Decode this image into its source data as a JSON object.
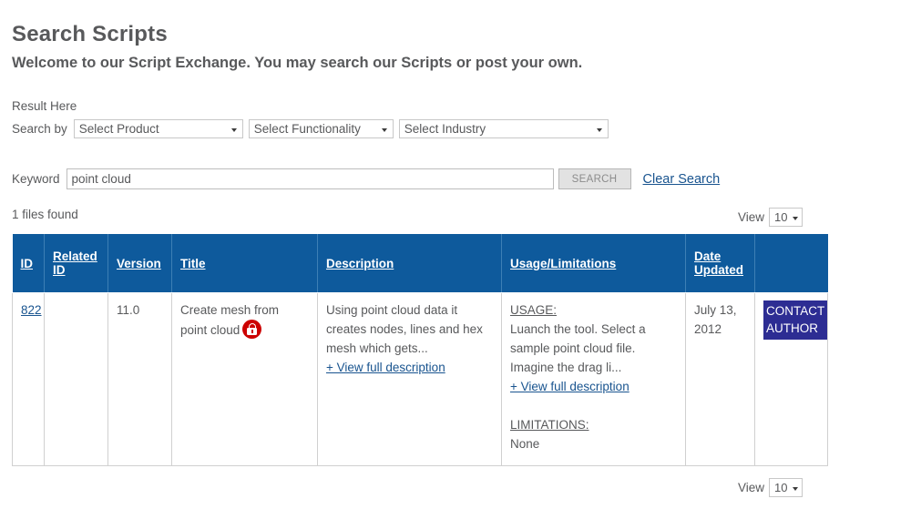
{
  "page": {
    "title": "Search Scripts",
    "subtitle": "Welcome to our Script Exchange. You may search our Scripts or post your own.",
    "result_here": "Result Here",
    "files_found": "1 files found"
  },
  "search": {
    "search_by_label": "Search by",
    "selects": [
      {
        "name": "product",
        "value": "Select Product"
      },
      {
        "name": "functionality",
        "value": "Select Functionality"
      },
      {
        "name": "industry",
        "value": "Select Industry"
      }
    ],
    "keyword_label": "Keyword",
    "keyword_value": "point cloud",
    "keyword_placeholder": "",
    "search_button": "SEARCH",
    "clear_search": "Clear Search"
  },
  "view": {
    "label": "View",
    "value": "10"
  },
  "table": {
    "headers": [
      "ID",
      "Related ID",
      "Version",
      "Title",
      "Description",
      "Usage/Limitations",
      "Date Updated",
      ""
    ],
    "rows": [
      {
        "id": "822",
        "related_id": "",
        "version": "11.0",
        "title": "Create mesh from point cloud",
        "title_icon": "lock-icon",
        "description": "Using point cloud data it creates nodes, lines and hex mesh which gets...",
        "description_link": "+ View full description",
        "usage_heading": "USAGE:",
        "usage_text": "Luanch the tool. Select a sample point cloud file. Imagine the drag li...",
        "usage_link": "+ View full description",
        "limitations_heading": "LIMITATIONS:",
        "limitations_text": "None",
        "date_updated": "July 13, 2012",
        "contact_line1": "CONTACT",
        "contact_line2": "AUTHOR"
      }
    ]
  },
  "colors": {
    "header_blue": "#0e5a9c",
    "link_blue": "#19548f",
    "contact_button": "#2d2d93",
    "lock_red": "#cc0000",
    "text_gray": "#58595b"
  }
}
